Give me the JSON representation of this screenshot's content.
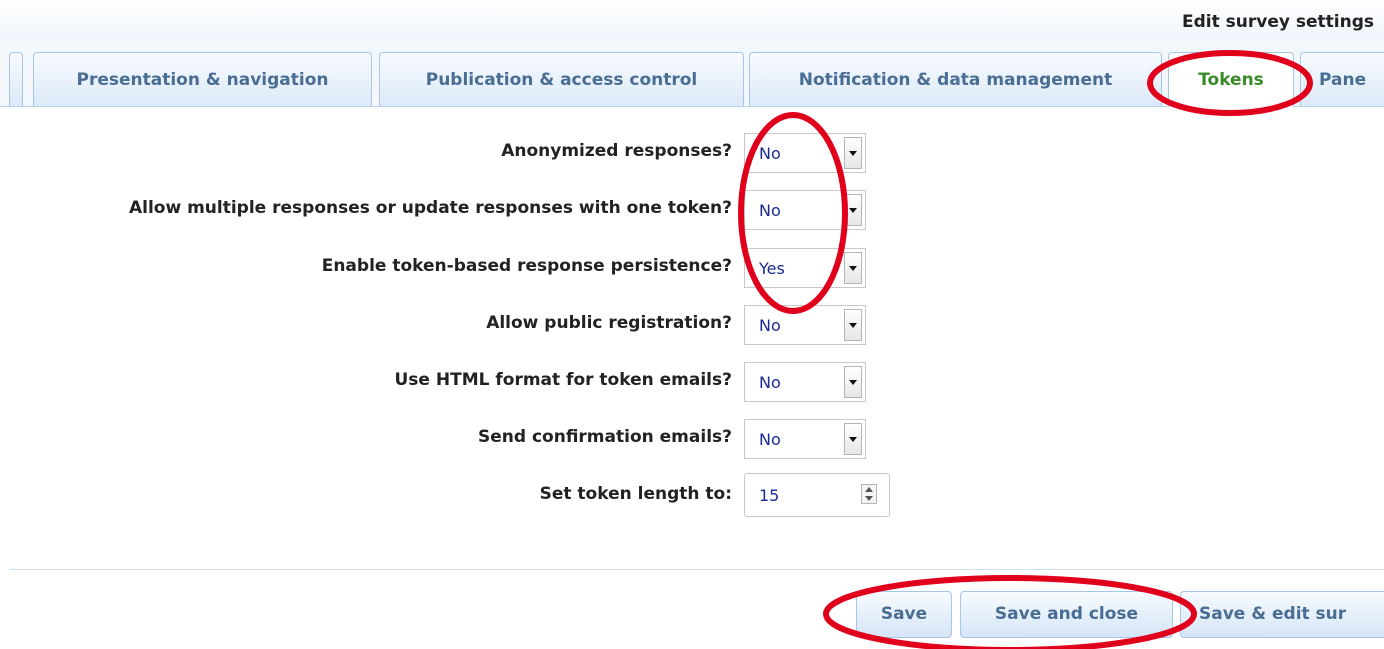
{
  "header": {
    "title": "Edit survey settings"
  },
  "tabs": [
    {
      "label": "Presentation & navigation",
      "active": false
    },
    {
      "label": "Publication & access control",
      "active": false
    },
    {
      "label": "Notification & data management",
      "active": false
    },
    {
      "label": "Tokens",
      "active": true
    },
    {
      "label": "Pane",
      "active": false
    }
  ],
  "settings": [
    {
      "label": "Anonymized responses?",
      "value": "No"
    },
    {
      "label": "Allow multiple responses or update responses with one token?",
      "value": "No"
    },
    {
      "label": "Enable token-based response persistence?",
      "value": "Yes"
    },
    {
      "label": "Allow public registration?",
      "value": "No"
    },
    {
      "label": "Use HTML format for token emails?",
      "value": "No"
    },
    {
      "label": "Send confirmation emails?",
      "value": "No"
    }
  ],
  "token_length": {
    "label": "Set token length to:",
    "value": "15"
  },
  "buttons": {
    "save": "Save",
    "save_close": "Save and close",
    "save_edit": "Save & edit sur"
  },
  "colors": {
    "annotation": "#e0001b",
    "active_tab_text": "#3a8a2a",
    "tab_text": "#4a6d94",
    "value_text": "#1a2a8f"
  },
  "icons": [
    "dropdown-arrow-icon",
    "spinner-arrows-icon"
  ]
}
